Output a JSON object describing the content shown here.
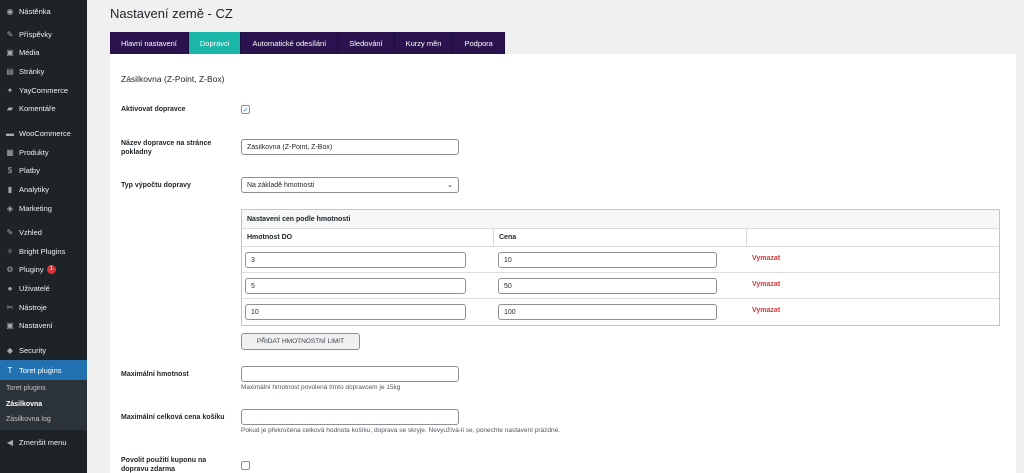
{
  "sidebar": {
    "items": [
      {
        "label": "Nástěnka",
        "icon": "dashboard-icon",
        "glyph": "◉"
      },
      {
        "label": "Příspěvky",
        "icon": "pin-icon",
        "glyph": "✎"
      },
      {
        "label": "Média",
        "icon": "media-icon",
        "glyph": "▣"
      },
      {
        "label": "Stránky",
        "icon": "pages-icon",
        "glyph": "▤"
      },
      {
        "label": "YayCommerce",
        "icon": "yay-icon",
        "glyph": "✦"
      },
      {
        "label": "Komentáře",
        "icon": "comments-icon",
        "glyph": "▰"
      },
      {
        "label": "WooCommerce",
        "icon": "woocommerce-icon",
        "glyph": "▬"
      },
      {
        "label": "Produkty",
        "icon": "products-icon",
        "glyph": "▦"
      },
      {
        "label": "Platby",
        "icon": "payments-icon",
        "glyph": "$"
      },
      {
        "label": "Analytiky",
        "icon": "analytics-icon",
        "glyph": "▮"
      },
      {
        "label": "Marketing",
        "icon": "marketing-icon",
        "glyph": "◈"
      },
      {
        "label": "Vzhled",
        "icon": "appearance-icon",
        "glyph": "✎"
      },
      {
        "label": "Bright Plugins",
        "icon": "bright-plugins-icon",
        "glyph": "✧"
      },
      {
        "label": "Pluginy",
        "icon": "plugins-icon",
        "glyph": "⚙",
        "badge": "1"
      },
      {
        "label": "Uživatelé",
        "icon": "users-icon",
        "glyph": "●"
      },
      {
        "label": "Nástroje",
        "icon": "tools-icon",
        "glyph": "✂"
      },
      {
        "label": "Nastavení",
        "icon": "settings-icon",
        "glyph": "▣"
      },
      {
        "label": "Security",
        "icon": "security-icon",
        "glyph": "◆"
      },
      {
        "label": "Toret plugins",
        "icon": "toret-icon",
        "glyph": "T",
        "active": true
      }
    ],
    "submenu": [
      "Toret plugins",
      "Zásilkovna",
      "Zásilkovna log"
    ],
    "collapse_label": "Zmenšit menu",
    "badge": "1"
  },
  "page": {
    "title": "Nastavení země - CZ"
  },
  "tabs": [
    {
      "label": "Hlavní nastavení"
    },
    {
      "label": "Dopravci",
      "active": true
    },
    {
      "label": "Automatické odesílání"
    },
    {
      "label": "Sledování"
    },
    {
      "label": "Kurzy měn"
    },
    {
      "label": "Podpora"
    }
  ],
  "section": {
    "title": "Zásilkovna (Z-Point, Z-Box)"
  },
  "form": {
    "activate_label": "Aktivovat dopravce",
    "activate_checked": true,
    "name_label_1": "Název dopravce na stránce",
    "name_label_2": "pokladny",
    "name_value": "Zásilkovna (Z-Point, Z-Box)",
    "calc_label": "Typ výpočtu dopravy",
    "calc_value": "Na základě hmotnosti",
    "max_weight_label": "Maximální hmotnost",
    "max_weight_value": "",
    "max_weight_desc": "Maximální hmotnost povolená tímto dopravcem je 15kg",
    "max_price_label": "Maximální celková cena košíku",
    "max_price_value": "",
    "max_price_desc": "Pokud je překročena celková hodnota košíku, doprava se skryje. Nevyužívá-li se, ponechte nastavení prázdné.",
    "coupon_label_1": "Povolit použití kuponu na",
    "coupon_label_2": "dopravu zdarma",
    "coupon_checked": false
  },
  "rate_table": {
    "title": "Nastavení cen podle hmotnosti",
    "col_weight": "Hmotnost DO",
    "col_price": "Cena",
    "rows": [
      {
        "weight": "3",
        "price": "10",
        "delete": "Vymazat"
      },
      {
        "weight": "5",
        "price": "50",
        "delete": "Vymazat"
      },
      {
        "weight": "10",
        "price": "100",
        "delete": "Vymazat"
      }
    ],
    "add_button": "PŘIDAT HMOTNOSTNÍ LIMIT"
  },
  "colors": {
    "sidebar": "#1d2327",
    "active_menu": "#2271b1",
    "tab": "#2b1350",
    "tab_active": "#1ab6a7",
    "delete": "#d63638"
  }
}
